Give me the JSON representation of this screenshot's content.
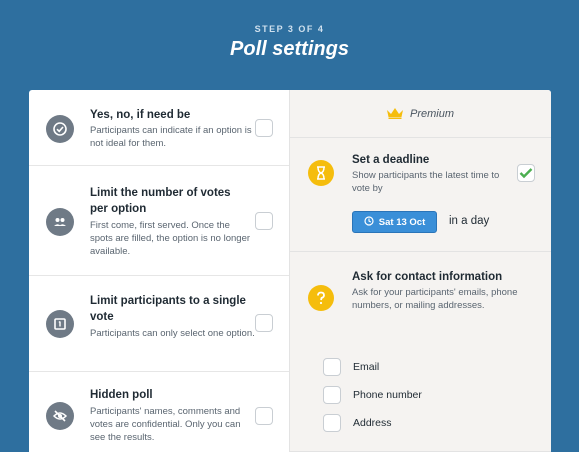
{
  "header": {
    "step": "STEP 3 OF 4",
    "title": "Poll settings"
  },
  "options": [
    {
      "title": "Yes, no, if need be",
      "desc": "Participants can indicate if an option is not ideal for them.",
      "icon": "check-circle-icon"
    },
    {
      "title": "Limit the number of votes per option",
      "desc": "First come, first served. Once the spots are filled, the option is no longer available.",
      "icon": "people-icon"
    },
    {
      "title": "Limit participants to a single vote",
      "desc": "Participants can only select one option.",
      "icon": "single-vote-icon"
    },
    {
      "title": "Hidden poll",
      "desc": "Participants' names, comments and votes are confidential. Only you can see the results.",
      "icon": "eye-off-icon"
    }
  ],
  "premium": {
    "label": "Premium",
    "icon": "crown-icon",
    "accent": "#f5bd0d"
  },
  "deadline": {
    "title": "Set a deadline",
    "desc": "Show participants the latest time to vote by",
    "date": "Sat 13 Oct",
    "suffix": "in a day",
    "checked": true
  },
  "contact": {
    "title": "Ask for contact information",
    "desc": "Ask for your participants' emails, phone numbers, or mailing addresses.",
    "fields": [
      "Email",
      "Phone number",
      "Address"
    ]
  },
  "colors": {
    "background": "#2e6f9f",
    "button": "#3a8fd8",
    "check": "#4caf50"
  }
}
